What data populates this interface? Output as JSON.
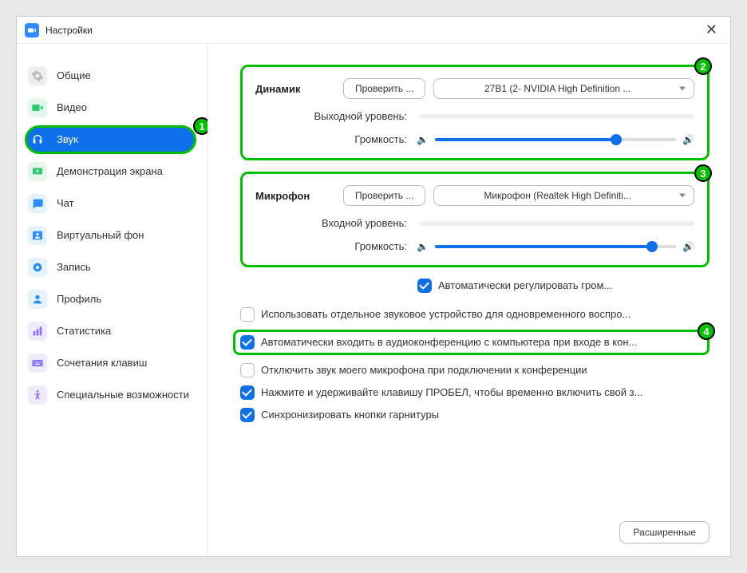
{
  "window": {
    "title": "Настройки"
  },
  "sidebar": {
    "items": [
      {
        "label": "Общие"
      },
      {
        "label": "Видео"
      },
      {
        "label": "Звук"
      },
      {
        "label": "Демонстрация экрана"
      },
      {
        "label": "Чат"
      },
      {
        "label": "Виртуальный фон"
      },
      {
        "label": "Запись"
      },
      {
        "label": "Профиль"
      },
      {
        "label": "Статистика"
      },
      {
        "label": "Сочетания клавиш"
      },
      {
        "label": "Специальные возможности"
      }
    ]
  },
  "speaker": {
    "title": "Динамик",
    "test_label": "Проверить ...",
    "device": "27B1 (2- NVIDIA High Definition ...",
    "output_level_label": "Выходной уровень:",
    "volume_label": "Громкость:",
    "volume_percent": 75
  },
  "microphone": {
    "title": "Микрофон",
    "test_label": "Проверить ...",
    "device": "Микрофон (Realtek High Definiti...",
    "input_level_label": "Входной уровень:",
    "volume_label": "Громкость:",
    "volume_percent": 90,
    "auto_adjust_label": "Автоматически регулировать гром..."
  },
  "options": {
    "separate_device": "Использовать отдельное звуковое устройство для одновременного воспро...",
    "auto_join_audio": "Автоматически входить в аудиоконференцию с компьютера при входе в кон...",
    "mute_on_join": "Отключить звук моего микрофона при подключении к конференции",
    "space_unmute": "Нажмите и удерживайте клавишу ПРОБЕЛ, чтобы временно включить свой з...",
    "sync_headset": "Синхронизировать кнопки гарнитуры"
  },
  "footer": {
    "advanced_label": "Расширенные"
  },
  "badges": {
    "b1": "1",
    "b2": "2",
    "b3": "3",
    "b4": "4"
  }
}
